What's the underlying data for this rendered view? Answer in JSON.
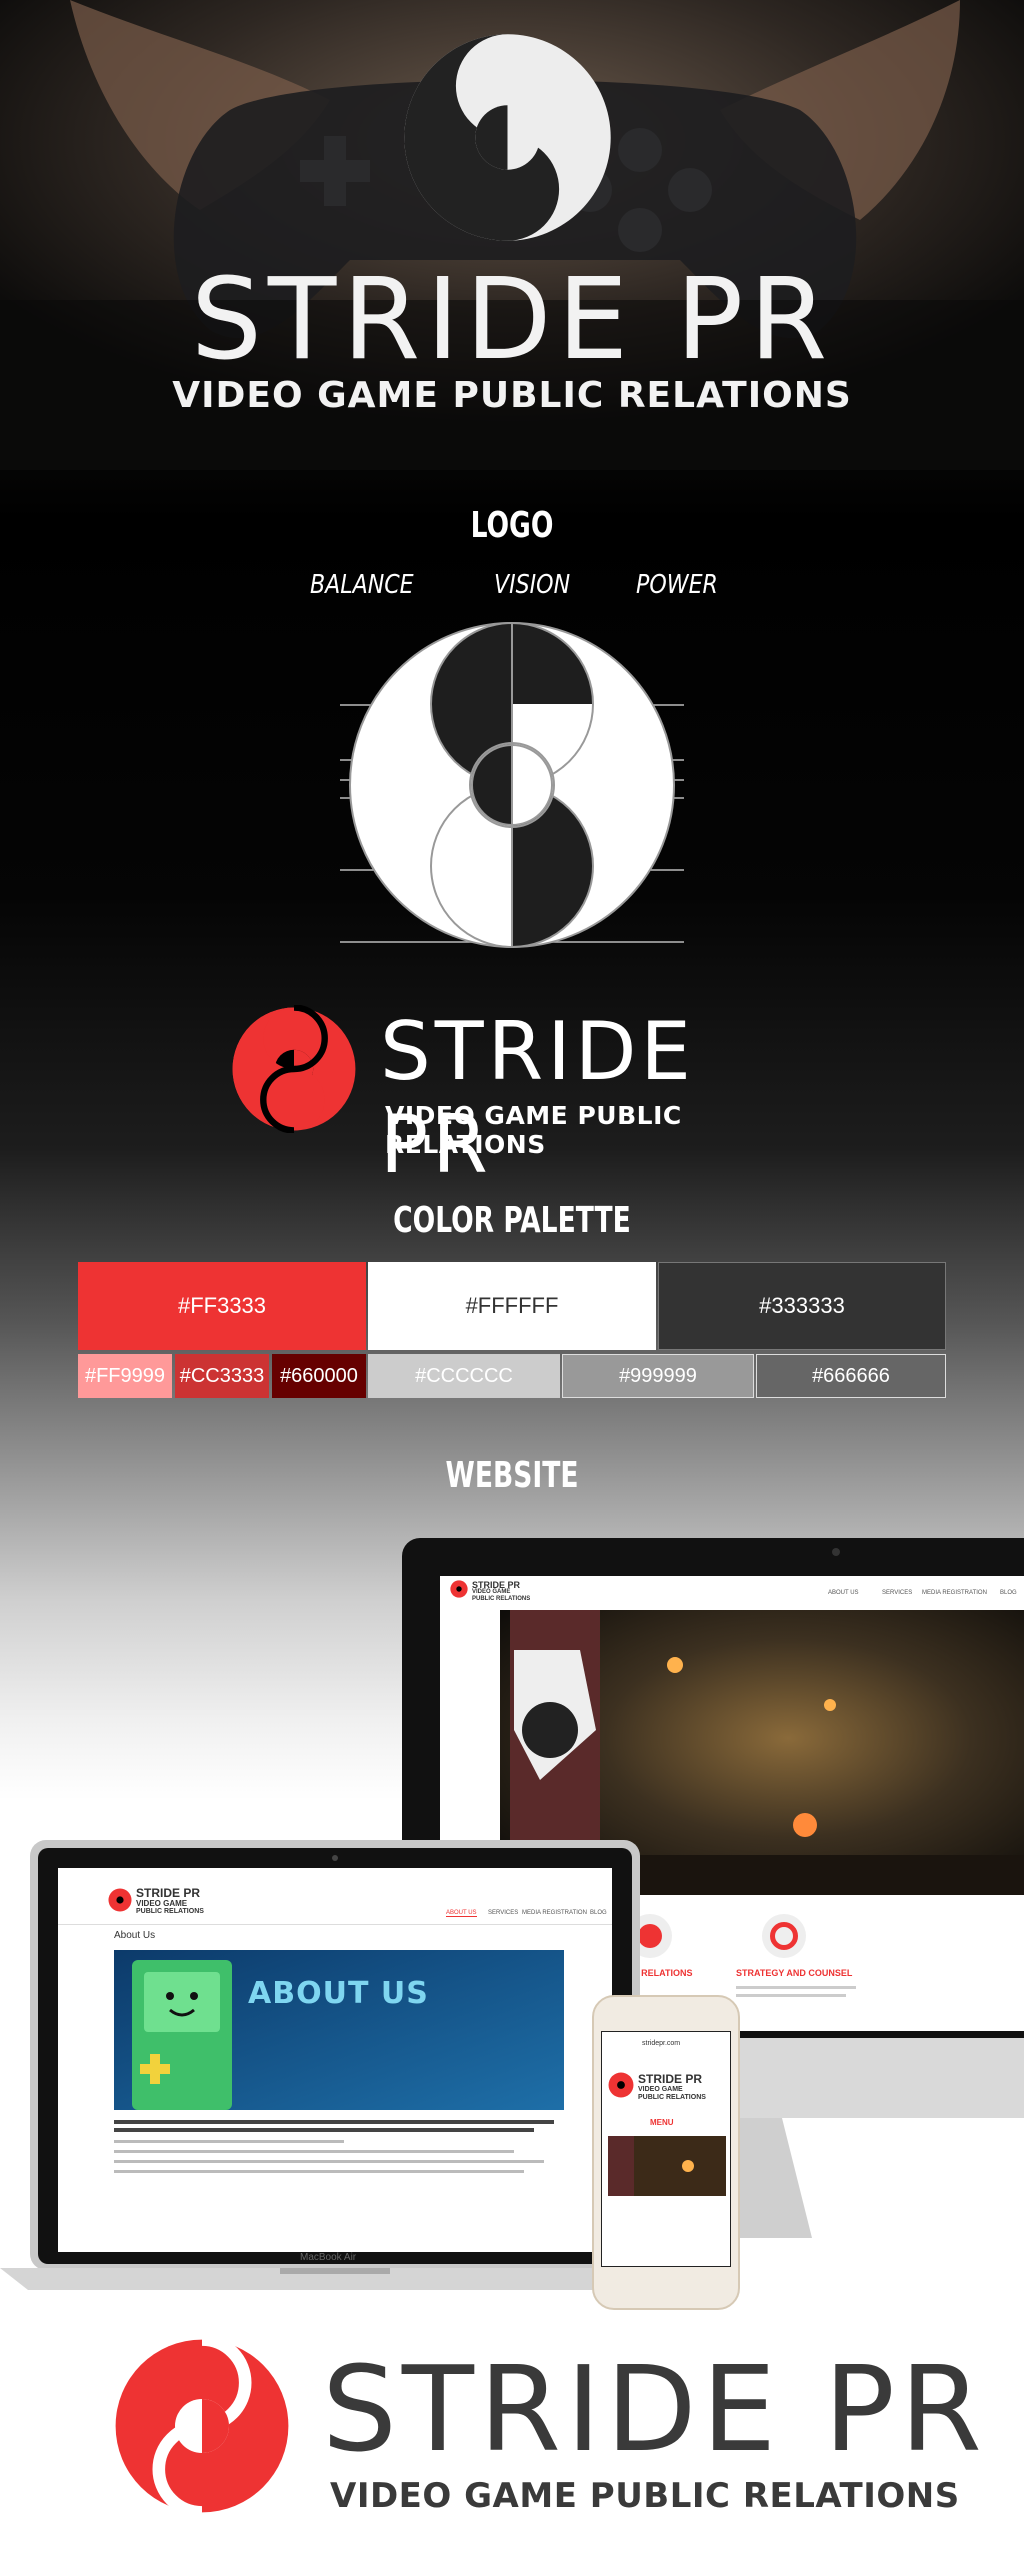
{
  "hero": {
    "title": "STRIDE PR",
    "subtitle": "VIDEO GAME PUBLIC RELATIONS"
  },
  "logo_section": {
    "heading": "LOGO",
    "keywords": [
      "BALANCE",
      "VISION",
      "POWER"
    ]
  },
  "brand": {
    "title": "STRIDE PR",
    "subtitle": "VIDEO GAME PUBLIC RELATIONS",
    "accent_color": "#EE3333"
  },
  "palette_section": {
    "heading": "COLOR PALETTE",
    "primary": [
      {
        "label": "#FF3333",
        "color": "#EE3333"
      },
      {
        "label": "#FFFFFF",
        "color": "#FFFFFF"
      },
      {
        "label": "#333333",
        "color": "#333333"
      }
    ],
    "secondary": [
      {
        "label": "#FF9999",
        "color": "#FF9999"
      },
      {
        "label": "#CC3333",
        "color": "#CC3333"
      },
      {
        "label": "#660000",
        "color": "#660000"
      },
      {
        "label": "#CCCCCC",
        "color": "#CCCCCC"
      },
      {
        "label": "#999999",
        "color": "#999999"
      },
      {
        "label": "#666666",
        "color": "#666666"
      }
    ]
  },
  "website_section": {
    "heading": "WEBSITE",
    "desktop_site": {
      "logo_title": "STRIDE PR",
      "logo_sub1": "VIDEO GAME",
      "logo_sub2": "PUBLIC RELATIONS",
      "nav": [
        "ABOUT US",
        "SERVICES",
        "MEDIA REGISTRATION",
        "BLOG"
      ],
      "features": [
        "MEDIA RELATIONS",
        "STRATEGY AND COUNSEL"
      ]
    },
    "laptop_site": {
      "logo_title": "STRIDE PR",
      "logo_sub1": "VIDEO GAME",
      "logo_sub2": "PUBLIC RELATIONS",
      "nav": [
        "ABOUT US",
        "SERVICES",
        "MEDIA REGISTRATION",
        "BLOG"
      ],
      "page_heading": "About Us",
      "banner_text": "ABOUT US",
      "laptop_label": "MacBook Air"
    },
    "phone_site": {
      "url": "stridepr.com",
      "logo_title": "STRIDE PR",
      "logo_sub1": "VIDEO GAME",
      "logo_sub2": "PUBLIC RELATIONS",
      "menu": "MENU"
    }
  },
  "footer": {
    "title": "STRIDE PR",
    "subtitle": "VIDEO GAME PUBLIC RELATIONS"
  }
}
